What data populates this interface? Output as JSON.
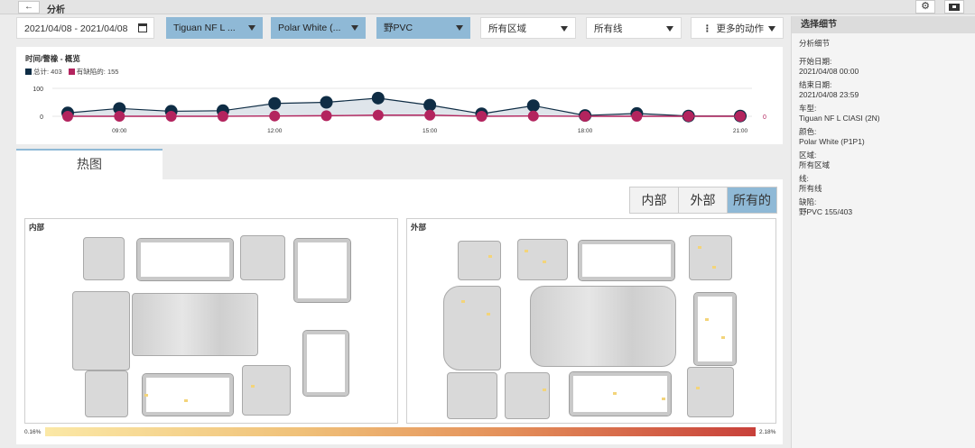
{
  "topbar": {
    "back_icon": "arrow-left-icon",
    "title": "分析"
  },
  "filters": {
    "date_range": "2021/04/08 - 2021/04/08",
    "model": "Tiguan NF L ...",
    "color": "Polar White (...",
    "defect": "野PVC",
    "zone": "所有区域",
    "line": "所有线",
    "more_actions": "更多的动作"
  },
  "chart": {
    "title": "时间/警橡 - 概览",
    "legend": [
      {
        "label": "总计: 403",
        "color": "#0f2d45"
      },
      {
        "label": "有缺陷的: 155",
        "color": "#b3245e"
      }
    ],
    "end_label": "0"
  },
  "chart_data": {
    "type": "line",
    "x": [
      "08:00",
      "09:00",
      "10:00",
      "11:00",
      "12:00",
      "13:00",
      "14:00",
      "15:00",
      "16:00",
      "17:00",
      "18:00",
      "19:00",
      "20:00",
      "21:00"
    ],
    "x_tick_labels": [
      "09:00",
      "12:00",
      "15:00",
      "18:00",
      "21:00"
    ],
    "ylim": [
      0,
      100
    ],
    "y_ticks": [
      "100",
      "0"
    ],
    "series": [
      {
        "name": "总计: 403",
        "color": "#0f2d45",
        "values": [
          12,
          28,
          18,
          20,
          46,
          50,
          65,
          40,
          9,
          38,
          3,
          10,
          1,
          1
        ]
      },
      {
        "name": "有缺陷的: 155",
        "color": "#b3245e",
        "values": [
          0,
          0,
          0,
          0,
          1,
          2,
          4,
          4,
          0,
          1,
          0,
          0,
          0,
          0
        ]
      }
    ]
  },
  "tabs": {
    "heatmap": "热图"
  },
  "segments": {
    "inside": "内部",
    "outside": "外部",
    "all": "所有的"
  },
  "heatmap": {
    "inside_label": "内部",
    "outside_label": "外部",
    "scale_min": "0.16%",
    "scale_max": "2.18%"
  },
  "sidebar": {
    "title": "选择细节",
    "subtitle": "分析细节",
    "start_label": "开始日期:",
    "start_value": "2021/04/08 00:00",
    "end_label": "结束日期:",
    "end_value": "2021/04/08 23:59",
    "model_label": "车型:",
    "model_value": "Tiguan NF L CIASI (2N)",
    "color_label": "颜色:",
    "color_value": "Polar White (P1P1)",
    "zone_label": "区域:",
    "zone_value": "所有区域",
    "line_label": "线:",
    "line_value": "所有线",
    "defect_label": "缺陷:",
    "defect_value": "野PVC 155/403"
  }
}
